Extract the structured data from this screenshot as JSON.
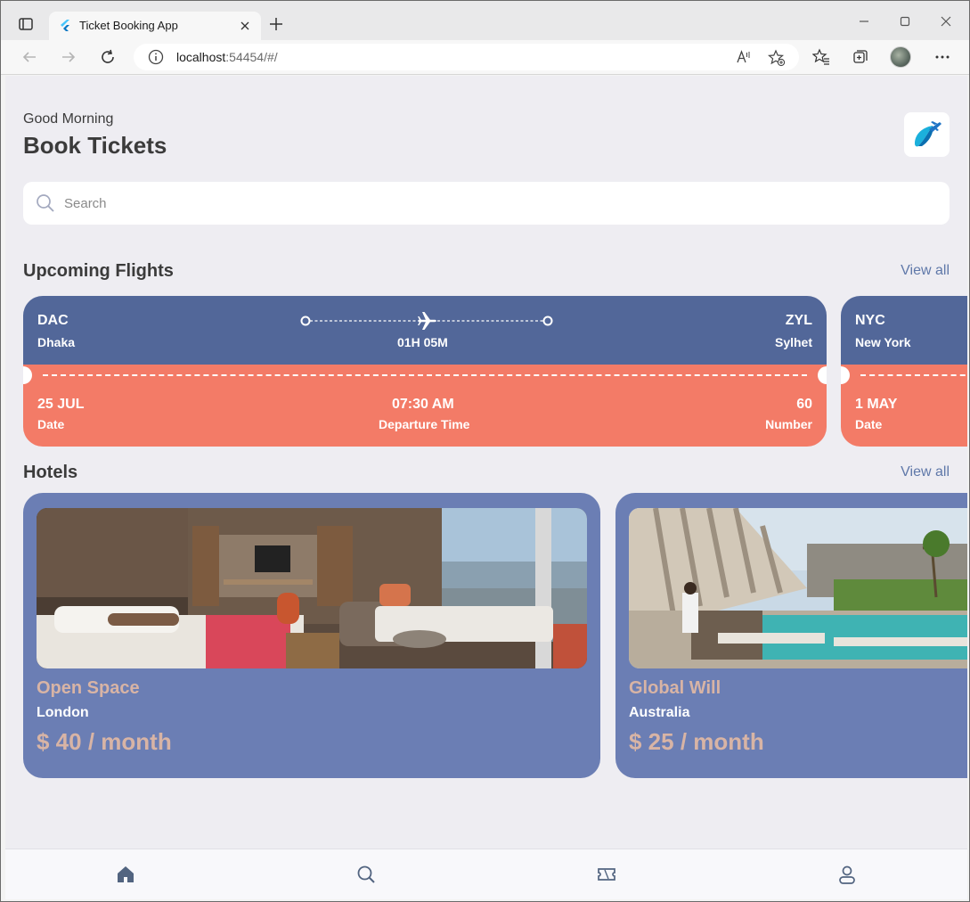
{
  "browser": {
    "tab_title": "Ticket Booking App",
    "url_host": "localhost",
    "url_rest": ":54454/#/"
  },
  "header": {
    "greeting": "Good Morning",
    "title": "Book Tickets"
  },
  "search": {
    "placeholder": "Search"
  },
  "flights": {
    "section_title": "Upcoming Flights",
    "view_all": "View all",
    "tickets": [
      {
        "from_code": "DAC",
        "from_city": "Dhaka",
        "to_code": "ZYL",
        "to_city": "Sylhet",
        "duration": "01H 05M",
        "date": "25 JUL",
        "date_label": "Date",
        "time": "07:30 AM",
        "time_label": "Departure Time",
        "number": "60",
        "number_label": "Number"
      },
      {
        "from_code": "NYC",
        "from_city": "New York",
        "date": "1 MAY",
        "date_label": "Date"
      }
    ]
  },
  "hotels": {
    "section_title": "Hotels",
    "view_all": "View all",
    "items": [
      {
        "name": "Open Space",
        "city": "London",
        "price": "$ 40 / month"
      },
      {
        "name": "Global Will",
        "city": "Australia",
        "price": "$ 25 / month"
      }
    ]
  },
  "nav": [
    "home-icon",
    "search-icon",
    "ticket-icon",
    "profile-icon"
  ],
  "colors": {
    "ticket_top": "#526799",
    "ticket_bottom": "#f37b67",
    "hotel_card": "#6b7eb4",
    "accent_link": "#5f78a9",
    "hotel_name": "#d8b4a5"
  }
}
